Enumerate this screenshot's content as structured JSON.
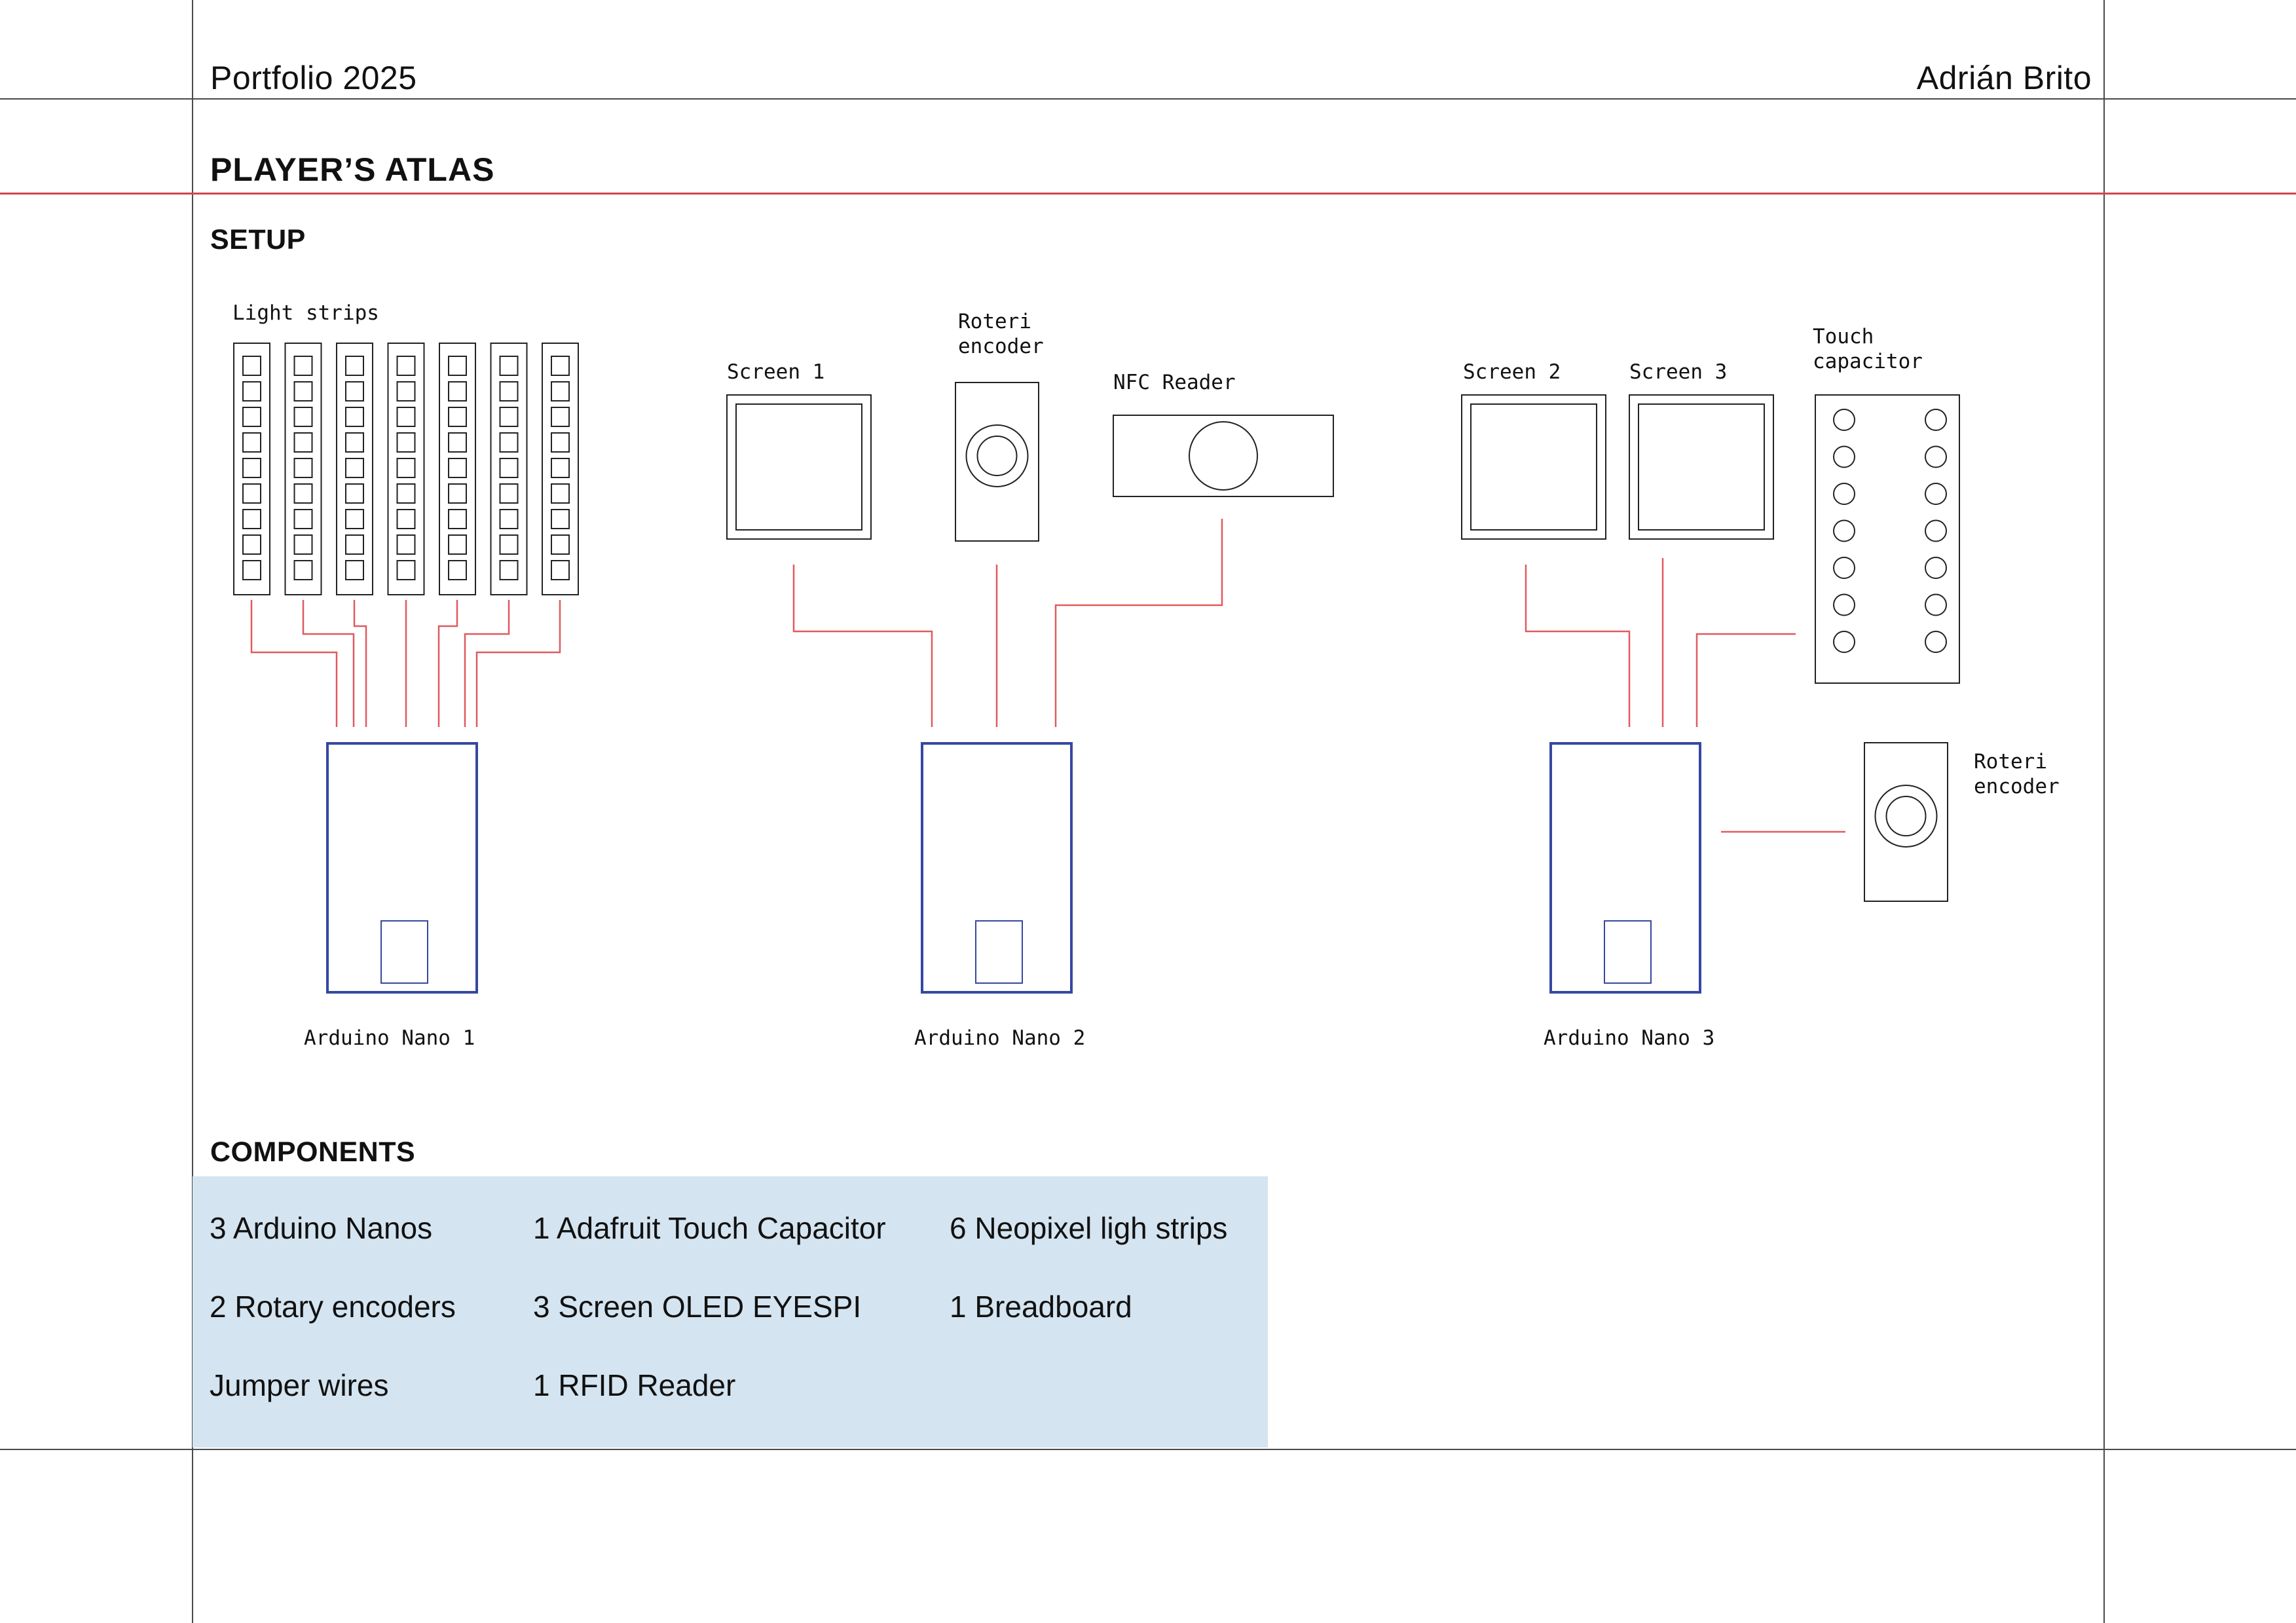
{
  "header": {
    "portfolio": "Portfolio 2025",
    "author": "Adrián Brito"
  },
  "project_title": "PLAYER’S ATLAS",
  "setup": {
    "heading": "SETUP",
    "labels": {
      "light_strips": "Light strips",
      "screen_1": "Screen 1",
      "rotary_1_line1": "Roteri",
      "rotary_1_line2": "encoder",
      "nfc_reader": "NFC Reader",
      "screen_2": "Screen 2",
      "screen_3": "Screen 3",
      "touch_line1": "Touch",
      "touch_line2": "capacitor",
      "rotary_2_line1": "Roteri",
      "rotary_2_line2": "encoder",
      "arduino_1": "Arduino Nano 1",
      "arduino_2": "Arduino Nano 2",
      "arduino_3": "Arduino Nano 3"
    },
    "colors": {
      "wire": "#e05a5f",
      "board": "#3548a0",
      "outline": "#222222"
    }
  },
  "components": {
    "heading": "COMPONENTS",
    "items": [
      "3 Arduino Nanos",
      "1 Adafruit Touch Capacitor",
      "6 Neopixel ligh strips",
      "2 Rotary encoders",
      "3 Screen OLED EYESPI",
      "1 Breadboard",
      "Jumper wires",
      "1 RFID Reader"
    ],
    "background": "#d4e4f0"
  }
}
